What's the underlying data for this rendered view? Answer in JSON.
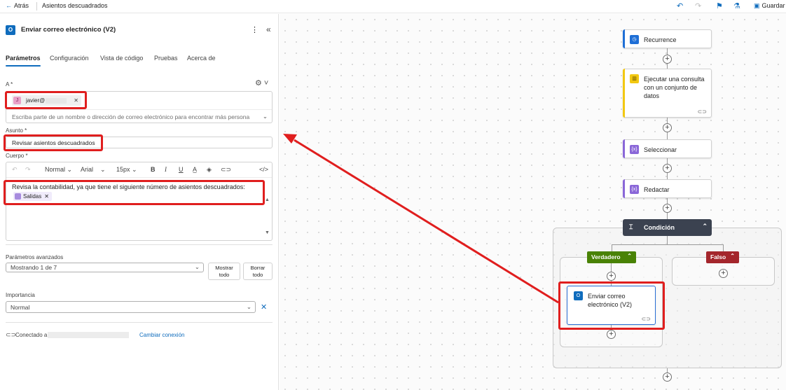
{
  "topbar": {
    "back_label": "Atrás",
    "flow_name": "Asientos descuadrados",
    "save_label": "Guardar"
  },
  "panel": {
    "title": "Enviar correo electrónico (V2)",
    "tabs": [
      "Parámetros",
      "Configuración",
      "Vista de código",
      "Pruebas",
      "Acerca de"
    ],
    "to": {
      "label": "A *",
      "chip_initial": "J",
      "chip_text": "javier@",
      "placeholder": "Escriba parte de un nombre o dirección de correo electrónico para encontrar más persona"
    },
    "subject": {
      "label": "Asunto *",
      "value": "Revisar asientos descuadrados"
    },
    "body": {
      "label": "Cuerpo *",
      "style": "Normal",
      "font": "Arial",
      "size": "15px",
      "text": "Revisa la contabilidad, ya que tiene el siguiente número de asientos descuadrados:",
      "token": "Salidas"
    },
    "advanced": {
      "label": "Parámetros avanzados",
      "value": "Mostrando 1 de 7",
      "show_all": [
        "Mostrar",
        "todo"
      ],
      "clear_all": [
        "Borrar",
        "todo"
      ]
    },
    "importance": {
      "label": "Importancia",
      "value": "Normal"
    },
    "connection": {
      "label": "Conectado a",
      "change_label": "Cambiar conexión"
    }
  },
  "flow": {
    "nodes": [
      {
        "label": "Recurrence",
        "color": "#1f6fd6"
      },
      {
        "label": "Ejecutar una consulta con un conjunto de datos",
        "lines": [
          "Ejecutar una consulta",
          "con un conjunto de",
          "datos"
        ],
        "color": "#f2c811"
      },
      {
        "label": "Seleccionar",
        "color": "#8a67d8"
      },
      {
        "label": "Redactar",
        "color": "#8a67d8"
      }
    ],
    "condition": {
      "label": "Condición",
      "color": "#3b4250"
    },
    "true_branch": {
      "label": "Verdadero",
      "color": "#498205"
    },
    "false_branch": {
      "label": "Falso",
      "color": "#a4262c"
    },
    "email_node": {
      "lines": [
        "Enviar correo",
        "electrónico (V2)"
      ],
      "color": "#0f6cbd"
    }
  },
  "colors": {
    "accent": "#0f6cbd",
    "annotation": "#e01e1e"
  }
}
